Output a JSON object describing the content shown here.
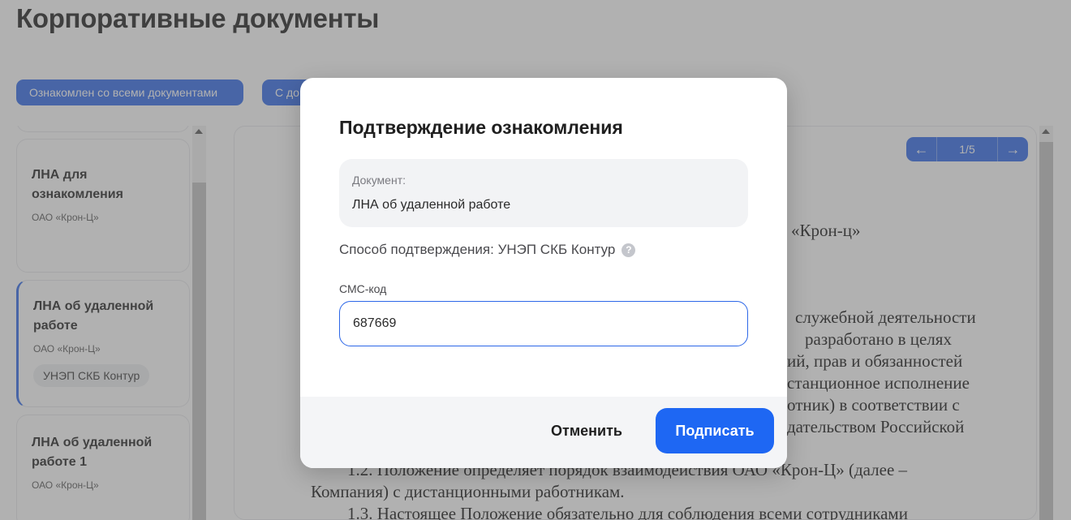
{
  "page": {
    "title": "Корпоративные документы",
    "actions": {
      "acknowledged_all": "Ознакомлен со всеми документами",
      "second_button": "С до"
    }
  },
  "sidebar": {
    "cards": [
      {
        "title": "ЛНА для ознакомления",
        "org": "ОАО «Крон-Ц»"
      },
      {
        "title": "ЛНА об удаленной работе",
        "org": "ОАО «Крон-Ц»",
        "badge": "УНЭП СКБ Контур",
        "selected": true
      },
      {
        "title": "ЛНА об удаленной работе 1",
        "org": "ОАО «Крон-Ц»"
      }
    ]
  },
  "viewer": {
    "pager": {
      "prev_icon": "arrow-left-icon",
      "page": "1/5",
      "next_icon": "arrow-right-icon"
    },
    "lines": [
      "«Крон-ц»",
      "служебной деятельности",
      "разработано    в    целях",
      "ий, прав и обязанностей",
      "станционное исполнение",
      "отник)   в соответствии с",
      "дательством   Российской",
      "1.2. Положение определяет порядок взаимодействия ОАО «Крон-Ц» (далее –",
      "Компания) с дистанционными работникам.",
      "1.3. Настоящее Положение обязательно для соблюдения всеми сотрудниками"
    ]
  },
  "modal": {
    "title": "Подтверждение ознакомления",
    "document_label": "Документ:",
    "document_value": "ЛНА об удаленной работе",
    "method_text": "Способ подтверждения: УНЭП СКБ Контур",
    "help_icon": "question-circle-icon",
    "sms_label": "СМС-код",
    "sms_value": "687669",
    "cancel_label": "Отменить",
    "sign_label": "Подписать"
  },
  "colors": {
    "accent": "#2c67e8",
    "sign_button": "#1e67f3",
    "overlay": "rgba(100,100,100,0.5)"
  }
}
